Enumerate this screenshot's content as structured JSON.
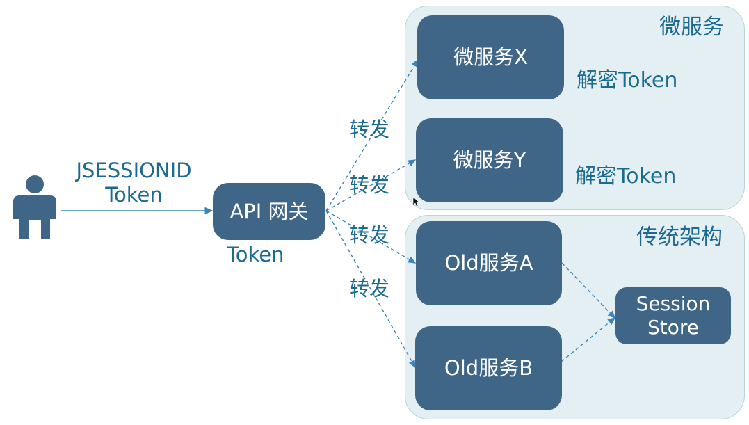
{
  "client": {
    "icon": "user-icon",
    "label": "JSESSIONID\nToken"
  },
  "gateway": {
    "label": "API 网关",
    "caption": "Token"
  },
  "microservice_group": {
    "title": "微服务",
    "services": [
      {
        "label": "微服务X",
        "note": "解密Token"
      },
      {
        "label": "微服务Y",
        "note": "解密Token"
      }
    ]
  },
  "legacy_group": {
    "title": "传统架构",
    "services": [
      {
        "label": "Old服务A"
      },
      {
        "label": "Old服务B"
      }
    ],
    "session_store": "Session\nStore"
  },
  "edges": {
    "forward_labels": [
      "转发",
      "转发",
      "转发",
      "转发"
    ]
  },
  "colors": {
    "node_fill": "#3f6587",
    "panel_fill": "#e4eff4",
    "accent_text": "#1d6a91",
    "edge": "#3a84b6"
  }
}
